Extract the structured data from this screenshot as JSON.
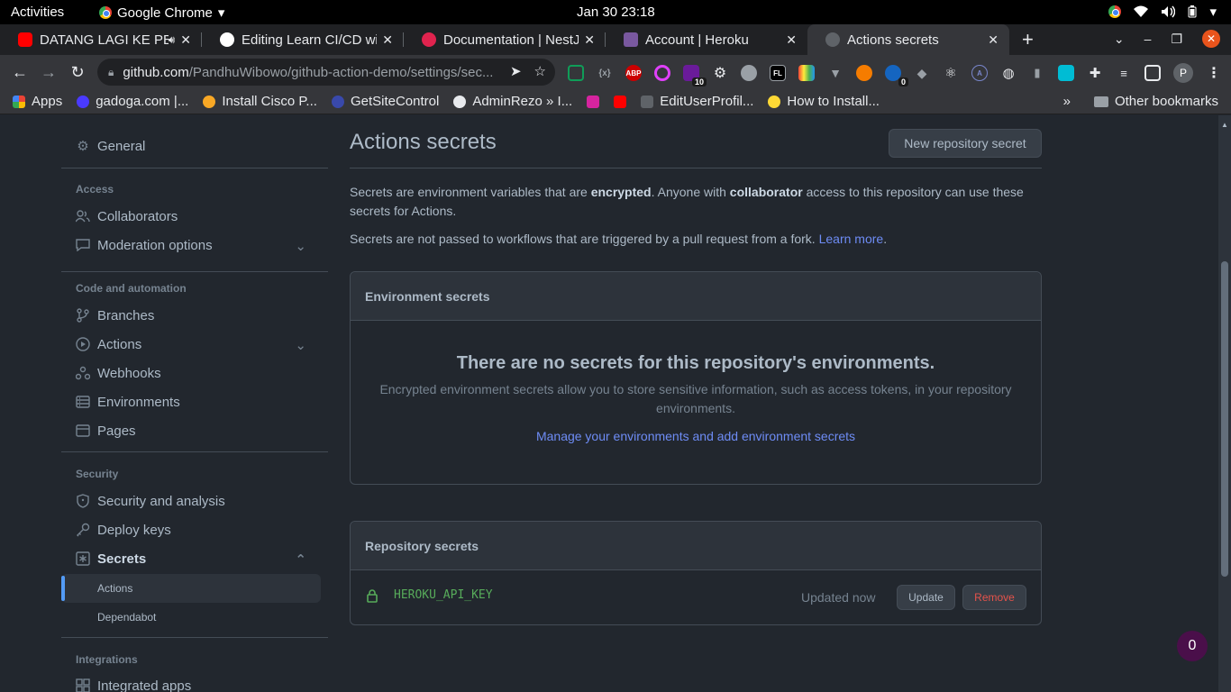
{
  "system": {
    "activities": "Activities",
    "app_name": "Google Chrome",
    "clock": "Jan 30  23:18"
  },
  "tabs": [
    {
      "title": "DATANG LAGI KE PE",
      "favicon": "youtube-icon"
    },
    {
      "title": "Editing Learn CI/CD wit",
      "favicon": "medium-icon"
    },
    {
      "title": "Documentation | NestJ",
      "favicon": "nestjs-icon"
    },
    {
      "title": "Account | Heroku",
      "favicon": "heroku-icon"
    },
    {
      "title": "Actions secrets",
      "favicon": "github-icon",
      "active": true
    }
  ],
  "omnibox": {
    "host": "github.com",
    "path": "/PandhuWibowo/github-action-demo/settings/sec..."
  },
  "extensions": {
    "badge_1": "10",
    "badge_2": "0",
    "profile_initial": "P"
  },
  "bookmarks": {
    "items": [
      "Apps",
      "gadoga.com |...",
      "Install Cisco P...",
      "GetSiteControl",
      "AdminRezo » I...",
      "EditUserProfil...",
      "How to Install..."
    ],
    "more": "»",
    "other": "Other bookmarks"
  },
  "sidebar": {
    "general": "General",
    "access_heading": "Access",
    "collaborators": "Collaborators",
    "moderation": "Moderation options",
    "code_heading": "Code and automation",
    "branches": "Branches",
    "actions": "Actions",
    "webhooks": "Webhooks",
    "environments": "Environments",
    "pages": "Pages",
    "security_heading": "Security",
    "security_analysis": "Security and analysis",
    "deploy_keys": "Deploy keys",
    "secrets": "Secrets",
    "secrets_actions": "Actions",
    "secrets_dependabot": "Dependabot",
    "integrations_heading": "Integrations",
    "integrated_apps": "Integrated apps"
  },
  "main": {
    "title": "Actions secrets",
    "new_secret_button": "New repository secret",
    "intro_1a": "Secrets are environment variables that are ",
    "intro_1b": "encrypted",
    "intro_1c": ". Anyone with ",
    "intro_1d": "collaborator",
    "intro_1e": " access to this repository can use these secrets for Actions.",
    "intro_2": "Secrets are not passed to workflows that are triggered by a pull request from a fork. ",
    "learn_more": "Learn more",
    "period": ".",
    "env_heading": "Environment secrets",
    "env_blank_title": "There are no secrets for this repository's environments.",
    "env_blank_desc": "Encrypted environment secrets allow you to store sensitive information, such as access tokens, in your repository environments.",
    "env_manage_link": "Manage your environments and add environment secrets",
    "repo_heading": "Repository secrets",
    "secret_name": "HEROKU_API_KEY",
    "secret_updated": "Updated now",
    "update_button": "Update",
    "remove_button": "Remove"
  },
  "fab_count": "0"
}
